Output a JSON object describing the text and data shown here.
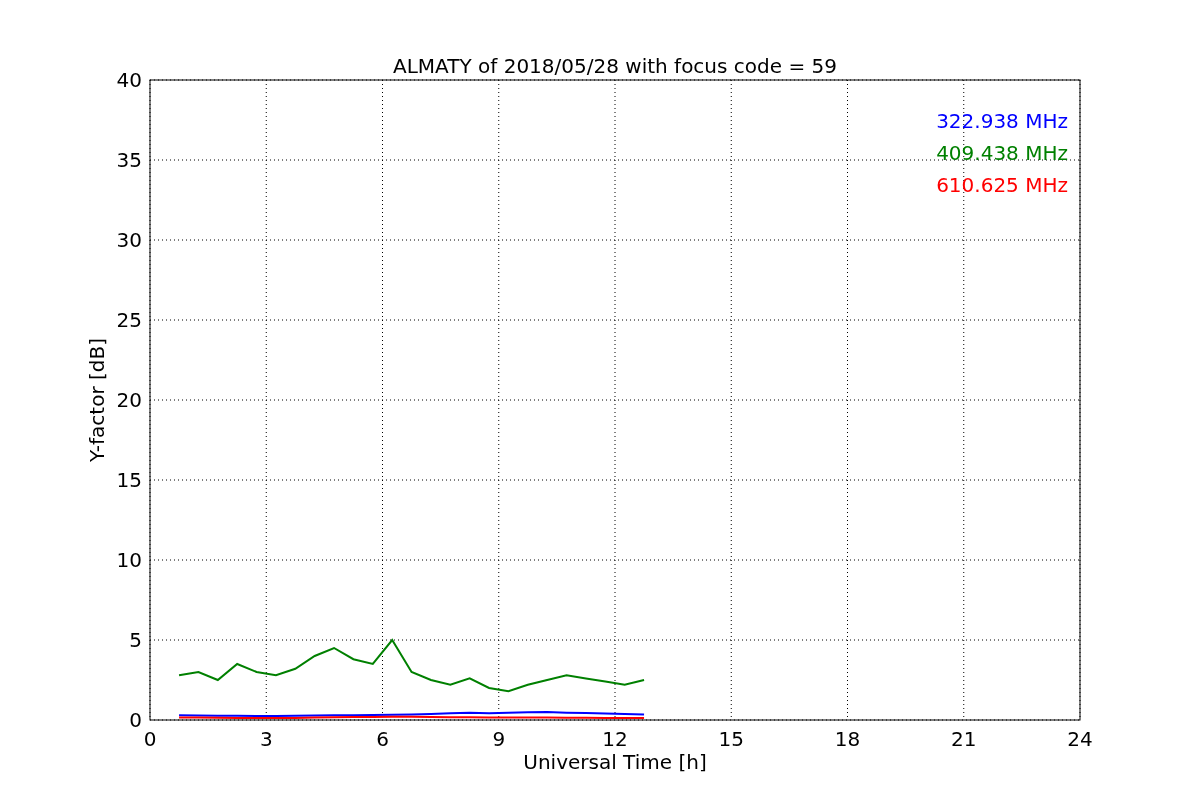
{
  "chart_data": {
    "type": "line",
    "title": "ALMATY of 2018/05/28 with focus code = 59",
    "xlabel": "Universal Time [h]",
    "ylabel": "Y-factor [dB]",
    "x": [
      0.75,
      1.25,
      1.75,
      2.25,
      2.75,
      3.25,
      3.75,
      4.25,
      4.75,
      5.25,
      5.75,
      6.25,
      6.75,
      7.25,
      7.75,
      8.25,
      8.75,
      9.25,
      9.75,
      10.25,
      10.75,
      11.25,
      11.75,
      12.25,
      12.75
    ],
    "series": [
      {
        "name": "322.938 MHz",
        "color": "#0000ff",
        "values": [
          0.3,
          0.28,
          0.27,
          0.26,
          0.25,
          0.25,
          0.26,
          0.28,
          0.3,
          0.3,
          0.32,
          0.33,
          0.35,
          0.38,
          0.42,
          0.45,
          0.42,
          0.45,
          0.48,
          0.5,
          0.46,
          0.44,
          0.4,
          0.38,
          0.35
        ]
      },
      {
        "name": "409.438 MHz",
        "color": "#008000",
        "values": [
          2.8,
          3.0,
          2.5,
          3.5,
          3.0,
          2.8,
          3.2,
          4.0,
          4.5,
          3.8,
          3.5,
          5.0,
          3.0,
          2.5,
          2.2,
          2.6,
          2.0,
          1.8,
          2.2,
          2.5,
          2.8,
          2.6,
          2.4,
          2.2,
          2.5
        ]
      },
      {
        "name": "610.625 MHz",
        "color": "#ff0000",
        "values": [
          0.15,
          0.15,
          0.14,
          0.13,
          0.13,
          0.12,
          0.13,
          0.15,
          0.17,
          0.18,
          0.18,
          0.2,
          0.2,
          0.18,
          0.17,
          0.17,
          0.16,
          0.15,
          0.15,
          0.15,
          0.14,
          0.14,
          0.13,
          0.13,
          0.12
        ]
      }
    ],
    "grid": true,
    "xlim": [
      0,
      24
    ],
    "ylim": [
      0,
      40
    ],
    "xticks": [
      0,
      3,
      6,
      9,
      12,
      15,
      18,
      21,
      24
    ],
    "yticks": [
      0,
      5,
      10,
      15,
      20,
      25,
      30,
      35,
      40
    ]
  }
}
